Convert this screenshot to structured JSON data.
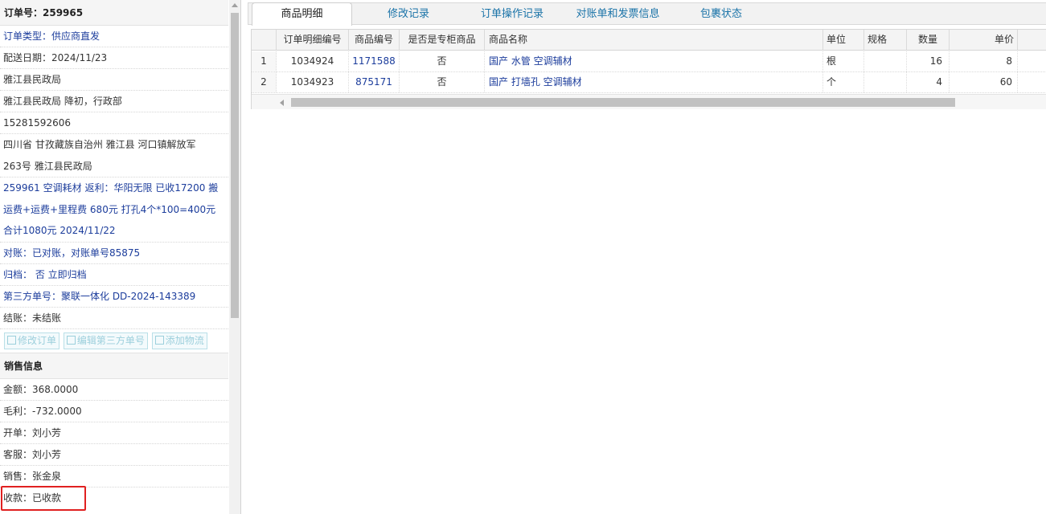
{
  "order": {
    "header": "订单号：259965",
    "type": "订单类型：供应商直发",
    "delivery_date": "配送日期：2024/11/23",
    "customer": "雅江县民政局",
    "contact": "雅江县民政局 降初，行政部",
    "phone": "15281592606",
    "address_lines": [
      "四川省 甘孜藏族自治州 雅江县 河口镇解放军",
      "263号 雅江县民政局"
    ],
    "remark_lines": [
      "259961 空调耗材 返利：华阳无限 已收17200 搬",
      "运费+运费+里程费 680元 打孔4个*100=400元",
      "合计1080元 2024/11/22"
    ],
    "reconcile": "对账：已对账，对账单号85875",
    "archive": "归档： 否 立即归档",
    "third_party": "第三方单号：聚联一体化 DD-2024-143389",
    "settlement": "结账：未结账",
    "buttons": {
      "edit_order": "修改订单",
      "edit_third_party": "编辑第三方单号",
      "add_logistics": "添加物流"
    }
  },
  "sales": {
    "header": "销售信息",
    "amount": "金额：368.0000",
    "gross_profit": "毛利：-732.0000",
    "creator": "开单：刘小芳",
    "service": "客服：刘小芳",
    "salesperson": "销售：张金泉",
    "payment": "收款：已收款"
  },
  "tabs": [
    {
      "label": "商品明细"
    },
    {
      "label": "修改记录"
    },
    {
      "label": "订单操作记录"
    },
    {
      "label": "对账单和发票信息"
    },
    {
      "label": "包裹状态"
    }
  ],
  "grid": {
    "columns": {
      "detail_no": "订单明细编号",
      "product_code": "商品编号",
      "special": "是否是专柜商品",
      "name": "商品名称",
      "unit": "单位",
      "spec": "规格",
      "qty": "数量",
      "price": "单价"
    },
    "rows": [
      {
        "idx": "1",
        "detail_no": "1034924",
        "product_code": "1171588",
        "special": "否",
        "name": "国产 水管 空调辅材",
        "unit": "根",
        "spec": "",
        "qty": "16",
        "price": "8"
      },
      {
        "idx": "2",
        "detail_no": "1034923",
        "product_code": "875171",
        "special": "否",
        "name": "国产 打墙孔 空调辅材",
        "unit": "个",
        "spec": "",
        "qty": "4",
        "price": "60"
      }
    ]
  },
  "icons": {
    "edit": "edit-icon",
    "scroll_up": "scroll-up-arrow-icon",
    "scroll_left": "scroll-left-arrow-icon"
  },
  "colors": {
    "link_blue": "#1c3d9c",
    "tab_blue": "#1a73a8",
    "highlight_red": "#e02020"
  }
}
